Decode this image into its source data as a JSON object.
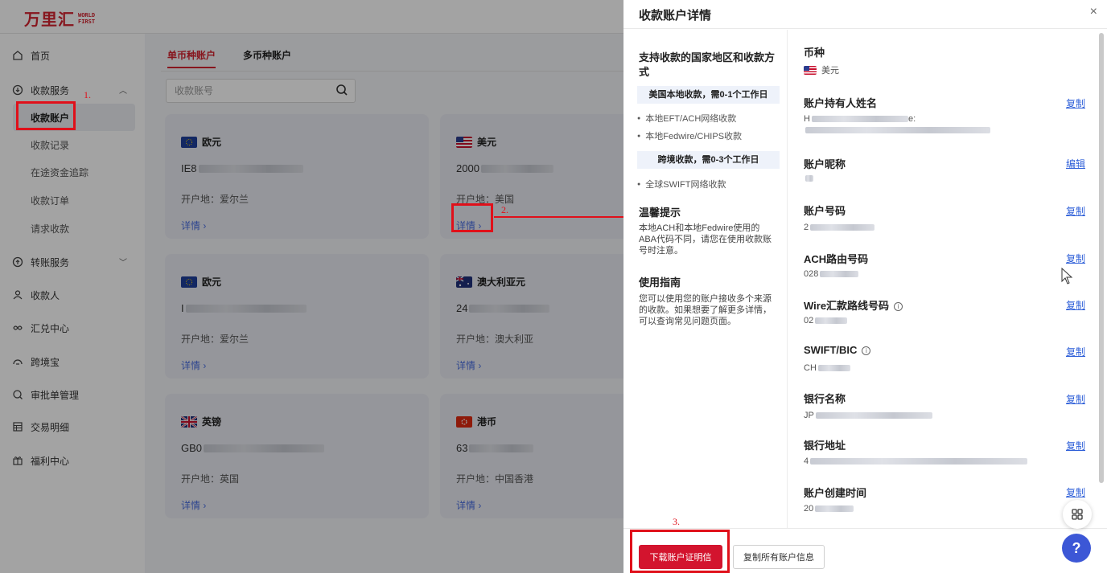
{
  "brand": {
    "name_cn": "万里汇",
    "name_en_1": "WORLD",
    "name_en_2": "FIRST",
    "color": "#d3232f"
  },
  "sidebar": {
    "items": [
      {
        "label": "首页",
        "icon": "home-icon"
      },
      {
        "label": "收款服务",
        "icon": "receive-icon"
      },
      {
        "label": "转账服务",
        "icon": "transfer-icon"
      },
      {
        "label": "收款人",
        "icon": "people-icon"
      },
      {
        "label": "汇兑中心",
        "icon": "exchange-icon"
      },
      {
        "label": "跨境宝",
        "icon": "crossborder-icon"
      },
      {
        "label": "审批单管理",
        "icon": "approval-icon"
      },
      {
        "label": "交易明细",
        "icon": "table-icon"
      },
      {
        "label": "福利中心",
        "icon": "gift-icon"
      }
    ],
    "sub_items": [
      "收款账户",
      "收款记录",
      "在途资金追踪",
      "收款订单",
      "请求收款"
    ]
  },
  "main": {
    "tabs": [
      "单币种账户",
      "多币种账户"
    ],
    "search_placeholder": "收款账号",
    "cards": [
      {
        "currency": "欧元",
        "flag": "eu",
        "acct_prefix": "IE8",
        "location": "开户地：爱尔兰",
        "detail": "详情"
      },
      {
        "currency": "美元",
        "flag": "us",
        "acct_prefix": "2000",
        "location": "开户地：美国",
        "detail": "详情"
      },
      {
        "currency": "欧元",
        "flag": "eu",
        "acct_prefix": "I",
        "location": "开户地：爱尔兰",
        "detail": "详情"
      },
      {
        "currency": "澳大利亚元",
        "flag": "au",
        "acct_prefix": "24",
        "location": "开户地：澳大利亚",
        "detail": "详情"
      },
      {
        "currency": "英镑",
        "flag": "gb",
        "acct_prefix": "GB0",
        "location": "开户地：英国",
        "detail": "详情"
      },
      {
        "currency": "港币",
        "flag": "hk",
        "acct_prefix": "63",
        "location": "开户地：中国香港",
        "detail": "详情"
      }
    ]
  },
  "drawer": {
    "title": "收款账户详情",
    "close": "×",
    "left": {
      "heading": "支持收款的国家地区和收款方式",
      "local_pill": "美国本地收款，需0-1个工作日",
      "local_methods": [
        "本地EFT/ACH网络收款",
        "本地Fedwire/CHIPS收款"
      ],
      "cross_pill": "跨境收款，需0-3个工作日",
      "cross_methods": [
        "全球SWIFT网络收款"
      ],
      "tip_title": "温馨提示",
      "tip_text": "本地ACH和本地Fedwire使用的ABA代码不同，请您在使用收款账号时注意。",
      "guide_title": "使用指南",
      "guide_text": "您可以使用您的账户接收多个来源的收款。如果想要了解更多详情，可以查询常见问题页面。"
    },
    "fields": [
      {
        "label": "币种",
        "value": "美元",
        "action": ""
      },
      {
        "label": "账户持有人姓名",
        "value": "H",
        "action": "复制"
      },
      {
        "label": "账户昵称",
        "value": "",
        "action": "编辑"
      },
      {
        "label": "账户号码",
        "value": "2",
        "action": "复制"
      },
      {
        "label": "ACH路由号码",
        "value": "028",
        "action": "复制"
      },
      {
        "label": "Wire汇款路线号码",
        "value": "02",
        "action": "复制"
      },
      {
        "label": "SWIFT/BIC",
        "value": "CH",
        "action": "复制"
      },
      {
        "label": "银行名称",
        "value": "JP",
        "action": "复制"
      },
      {
        "label": "银行地址",
        "value": "4",
        "action": "复制"
      },
      {
        "label": "账户创建时间",
        "value": "20",
        "action": "复制"
      }
    ],
    "holder_suffix": "e:",
    "info_glyph": "i",
    "download_btn": "下载账户证明信",
    "copy_all_btn": "复制所有账户信息"
  },
  "floating": {
    "help": "?"
  },
  "annotations": [
    "1.",
    "2.",
    "3."
  ]
}
